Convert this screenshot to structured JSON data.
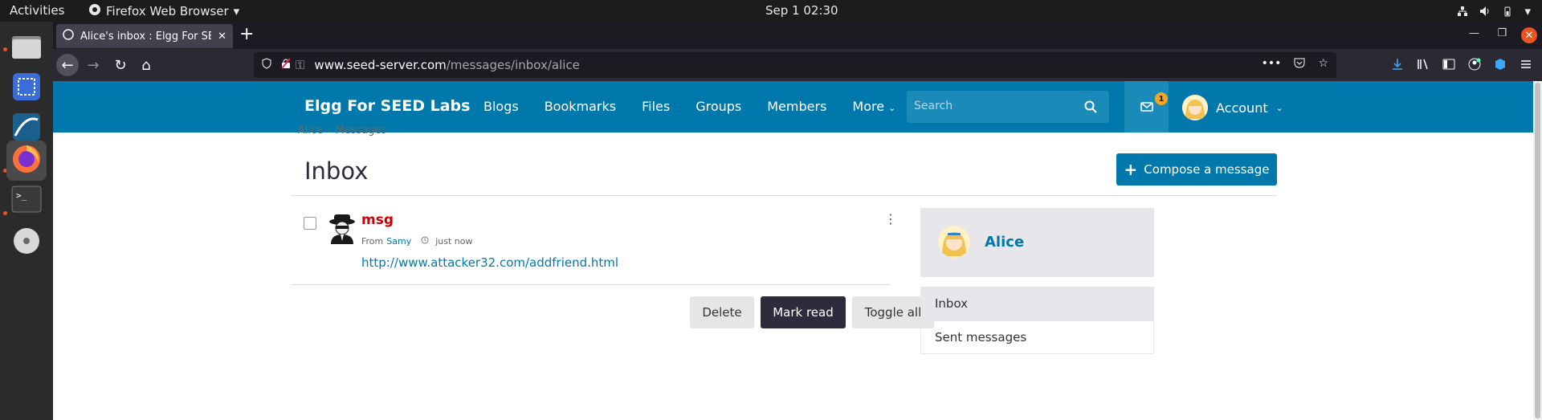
{
  "system": {
    "activities": "Activities",
    "app_menu": "Firefox Web Browser",
    "clock": "Sep 1  02:30"
  },
  "browser": {
    "tab_title": "Alice's inbox : Elgg For SE",
    "url_host": "www.seed-server.com",
    "url_path": "/messages/inbox/alice"
  },
  "site": {
    "title": "Elgg For SEED Labs",
    "nav": [
      "Blogs",
      "Bookmarks",
      "Files",
      "Groups",
      "Members",
      "More"
    ],
    "search_placeholder": "Search",
    "messages_badge": "1",
    "account_label": "Account"
  },
  "page": {
    "breadcrumb": [
      "Alice",
      "Messages"
    ],
    "title": "Inbox",
    "compose_label": "Compose a message"
  },
  "message": {
    "subject": "msg",
    "from_prefix": "From",
    "from_user": "Samy",
    "time": "just now",
    "body": "http://www.attacker32.com/addfriend.html"
  },
  "actions": {
    "delete": "Delete",
    "mark_read": "Mark read",
    "toggle_all": "Toggle all"
  },
  "sidebar": {
    "owner_name": "Alice",
    "menu": [
      "Inbox",
      "Sent messages"
    ]
  },
  "colors": {
    "brand": "#0078ac",
    "subject": "#cc0000",
    "badge": "#f5a623"
  }
}
